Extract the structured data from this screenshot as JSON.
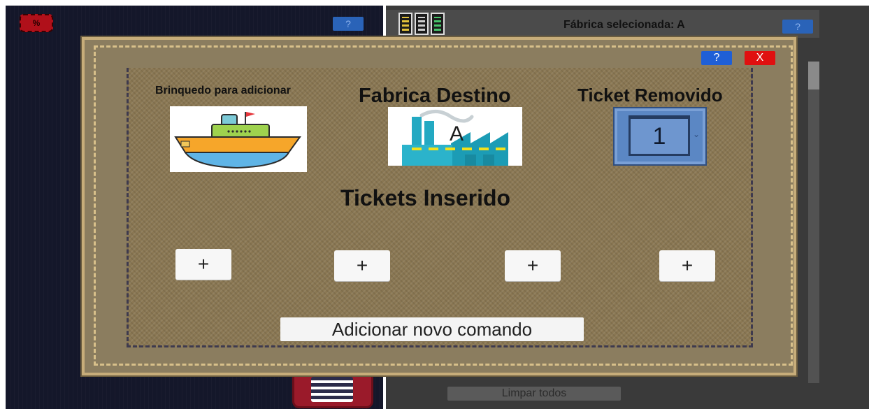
{
  "background": {
    "percent_badge": "%",
    "help_label": "?",
    "factory_selected": "Fábrica selecionada: A",
    "clear_all": "Limpar todos"
  },
  "modal": {
    "help_label": "?",
    "close_label": "X",
    "toy_heading": "Brinquedo para adicionar",
    "factory_heading": "Fabrica Destino",
    "ticket_removed_heading": "Ticket Removido",
    "factory_letter": "A",
    "ticket_removed_value": "1",
    "tickets_inserted_heading": "Tickets Inserido",
    "plus_label": "+",
    "add_command_label": "Adicionar novo comando"
  },
  "icons": [
    "percent-badge-icon",
    "column-bars-icon",
    "boat-toy-icon",
    "factory-icon",
    "chevron-down-icon",
    "checklist-icon"
  ],
  "colors": {
    "modal_bg": "#8b7d5f",
    "close_red": "#e01010",
    "help_blue": "#1f5fd6",
    "dropdown_blue": "#5b87c4"
  }
}
